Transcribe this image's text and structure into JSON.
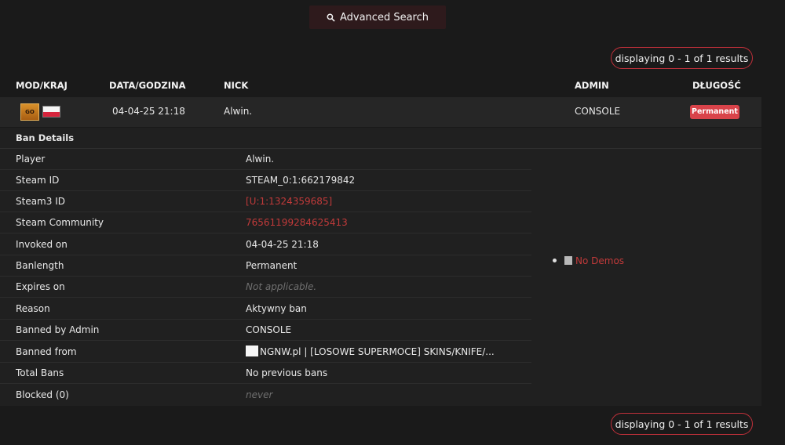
{
  "search": {
    "label": "Advanced Search"
  },
  "pagination": {
    "top": "displaying 0 - 1 of 1 results",
    "bottom": "displaying 0 - 1 of 1 results"
  },
  "table": {
    "headers": {
      "mod": "MOD/KRAJ",
      "date": "DATA/GODZINA",
      "nick": "NICK",
      "admin": "ADMIN",
      "length": "DŁUGOŚĆ"
    },
    "row": {
      "mod_icon_text": "GO",
      "date": "04-04-25 21:18",
      "nick": "Alwin.",
      "admin": "CONSOLE",
      "length": "Permanent"
    }
  },
  "details": {
    "title": "Ban Details",
    "rows": [
      {
        "label": "Player",
        "value": "Alwin."
      },
      {
        "label": "Steam ID",
        "value": "STEAM_0:1:662179842"
      },
      {
        "label": "Steam3 ID",
        "value": "[U:1:1324359685]"
      },
      {
        "label": "Steam Community",
        "value": "76561199284625413"
      },
      {
        "label": "Invoked on",
        "value": "04-04-25 21:18"
      },
      {
        "label": "Banlength",
        "value": "Permanent"
      },
      {
        "label": "Expires on",
        "value": "Not applicable."
      },
      {
        "label": "Reason",
        "value": "Aktywny ban"
      },
      {
        "label": "Banned by Admin",
        "value": "CONSOLE"
      },
      {
        "label": "Banned from",
        "value": "NGNW.pl | [LOSOWE SUPERMOCE] SKINS/KNIFE/..."
      },
      {
        "label": "Total Bans",
        "value": "No previous bans"
      },
      {
        "label": "Blocked (0)",
        "value": "never"
      }
    ],
    "demos": "No Demos"
  },
  "colors": {
    "accent": "#c0303a",
    "badge": "#d9434a",
    "link": "#c13a3a"
  }
}
